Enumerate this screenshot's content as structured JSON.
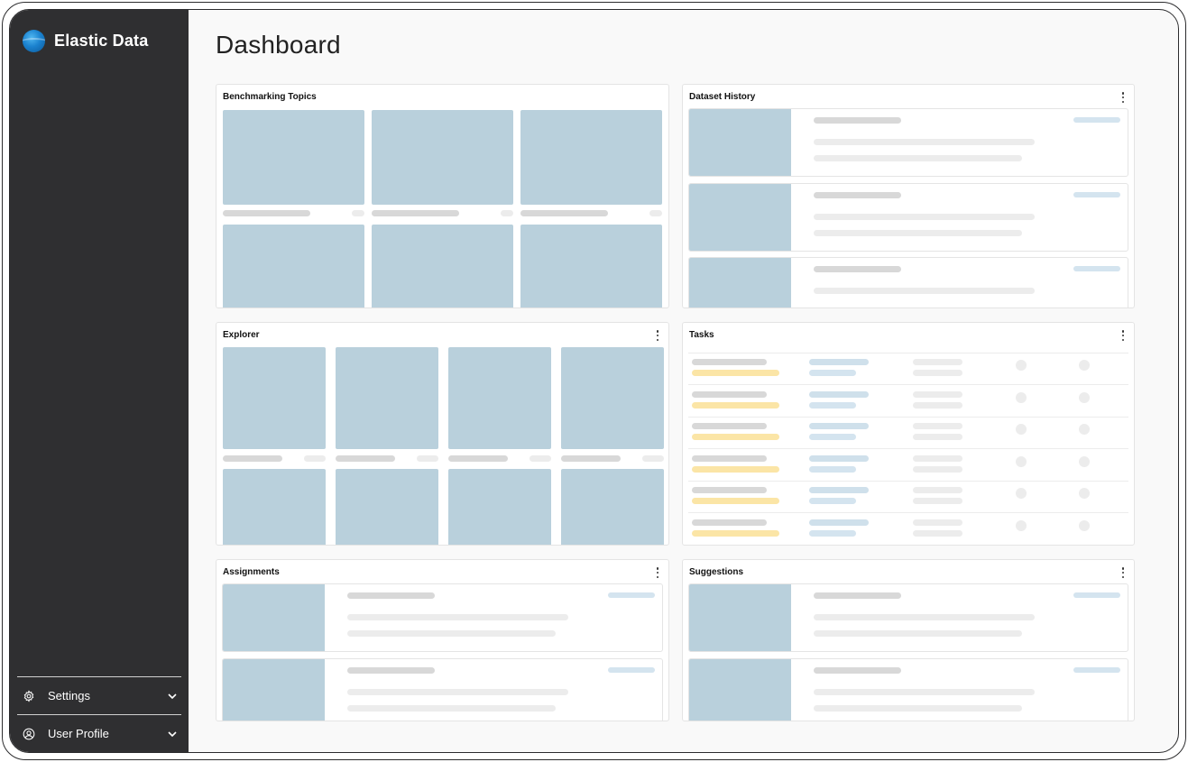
{
  "app": {
    "name": "Elastic Data",
    "logo_icon": "globe-logo-icon"
  },
  "sidebar": {
    "items": [
      {
        "label": "Settings",
        "icon": "gear-icon"
      },
      {
        "label": "User Profile",
        "icon": "user-circle-icon"
      }
    ]
  },
  "page": {
    "title": "Dashboard"
  },
  "cards": {
    "benchmarking": {
      "title": "Benchmarking Topics"
    },
    "dataset_history": {
      "title": "Dataset History"
    },
    "explorer": {
      "title": "Explorer"
    },
    "tasks": {
      "title": "Tasks"
    },
    "assignments": {
      "title": "Assignments"
    },
    "suggestions": {
      "title": "Suggestions"
    }
  },
  "colors": {
    "sidebar_bg": "#2f2f31",
    "placeholder_image": "#b9d0dc",
    "placeholder_text": "#d8d8d8",
    "placeholder_light": "#ececec",
    "placeholder_blue": "#d4e4ef",
    "placeholder_yellow": "#fbe5a6"
  }
}
